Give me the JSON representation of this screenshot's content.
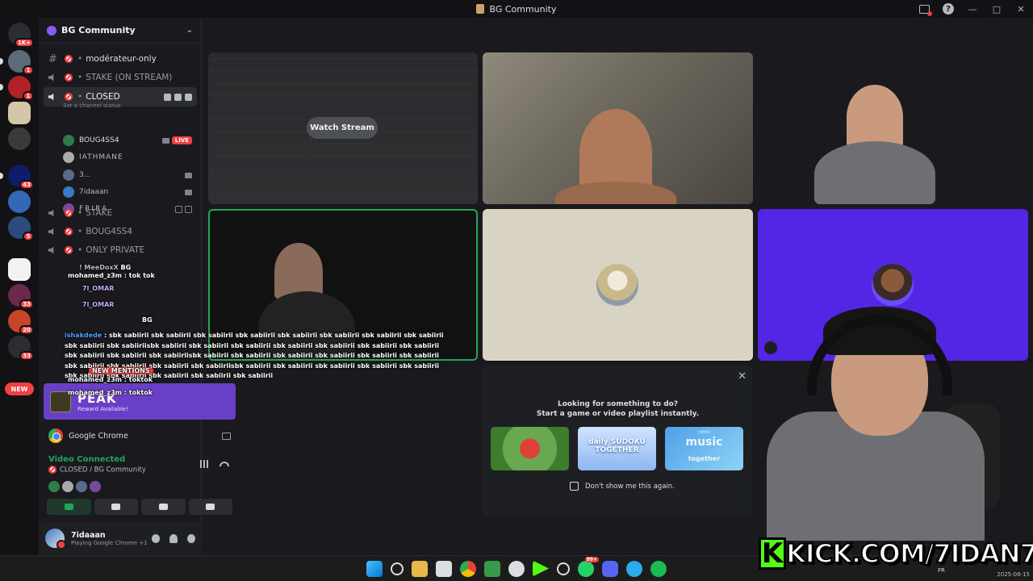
{
  "window": {
    "title": "BG Community"
  },
  "rail": {
    "top_badge": "1K+",
    "servers": [
      {
        "badge": "1"
      },
      {
        "badge": "1"
      },
      {
        "badge": ""
      },
      {
        "badge": ""
      },
      {
        "badge": "43"
      },
      {
        "badge": ""
      },
      {
        "badge": "5"
      },
      {
        "badge": ""
      },
      {
        "badge": ""
      },
      {
        "badge": "33"
      },
      {
        "badge": "20"
      },
      {
        "badge": "33"
      }
    ],
    "new_label": "NEW"
  },
  "sidebar": {
    "guild_name": "BG Community",
    "channels": {
      "moderateur": "modérateur-only",
      "stake_on_stream": "STAKE (ON STREAM)",
      "closed": "CLOSED",
      "closed_status": "Set a channel status",
      "stake": "STAKE",
      "boug4ss4": "BOUG4SS4",
      "only_private": "ONLY PRIVATE"
    },
    "closed_users": [
      {
        "name": "BOUG4SS4",
        "live": "LIVE"
      },
      {
        "name": "IATHMANE"
      },
      {
        "name": "3..."
      },
      {
        "name": "7idaaan"
      },
      {
        "name": "FRIRA"
      }
    ]
  },
  "chat": {
    "line1": "! MeeDoxX",
    "line1_tag": "BG",
    "line2": "mohamed_z3m : tok tok",
    "line3": "7l_OMAR",
    "line4": "7l_OMAR",
    "line4_tag": "BG",
    "spam_user": "ishakdede",
    "spam": " : sbk sabiirii sbk sabiirii sbk sabiirii sbk sabiirii sbk sabiirii sbk sabiirii sbk sabiirii sbk sabiirii sbk sabiirii sbk sabiiriisbk sabiirii sbk sabiirii sbk sabiirii sbk sabiirii sbk sabiirii sbk sabiirii sbk sabiirii sbk sabiirii sbk sabiirii sbk sabiiriisbk sabiirii sbk sabiirii sbk sabiirii sbk sabiirii sbk sabiirii sbk sabiirii sbk sabiirii sbk sabiirii sbk sabiirii sbk sabiiriisbk sabiirii sbk sabiirii sbk sabiirii sbk sabiirii sbk sabiirii sbk sabiirii sbk sabiirii sbk sabiirii sbk sabiirii sbk sabiirii",
    "line_new_mentions": "NEW MENTIONS",
    "line5": "mohamed_z3m : toktok",
    "line6": "mohamed_z3m : toktok"
  },
  "peak": {
    "title": "PEAK",
    "subtitle": "Reward Available!"
  },
  "activity_row": {
    "app": "Google Chrome"
  },
  "voice": {
    "status": "Video Connected",
    "location": "CLOSED / BG Community"
  },
  "user": {
    "name": "7idaaan",
    "activity": "Playing Google Chrome +1"
  },
  "stage": {
    "watch_stream": "Watch Stream"
  },
  "activity_popup": {
    "line1": "Looking for something to do?",
    "line2": "Start a game or video playlist instantly.",
    "card2_label": "daily SUDOKU TOGETHER",
    "card3_top": "rythm",
    "card3_label": "music",
    "card3_sub": "together",
    "dont_show": "Don't show me this again."
  },
  "overlay": {
    "kick_url": "KICK.COM/7IDAN7"
  },
  "taskbar": {
    "lang": "FR",
    "date": "2025-08-15",
    "badge1": "99+"
  },
  "colors": {
    "accent": "#5865f2",
    "online": "#23a55a",
    "danger": "#f23f42",
    "peak": "#6a3fc7",
    "kick": "#53fc18"
  }
}
